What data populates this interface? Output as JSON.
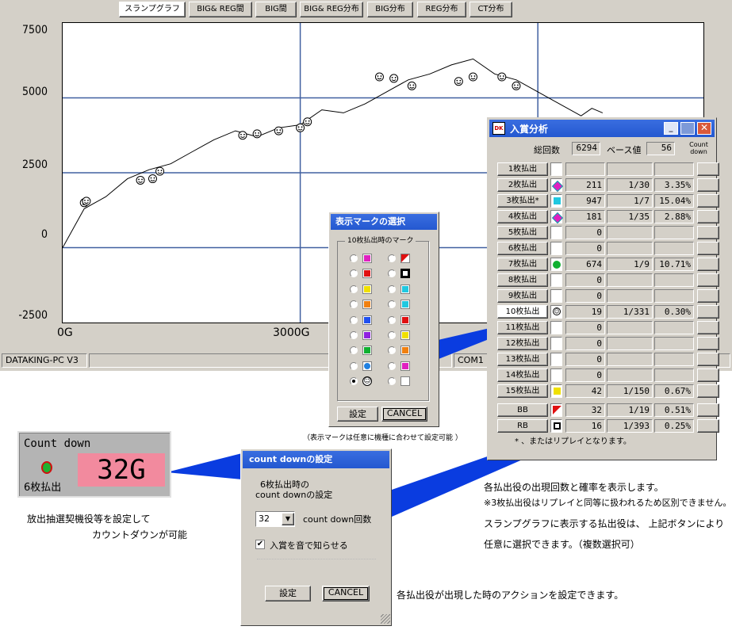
{
  "main_window": {
    "tabs": [
      {
        "label": "スランプグラフ",
        "active": true
      },
      {
        "label": "BIG& REG間",
        "active": false
      },
      {
        "label": "BIG間",
        "active": false
      },
      {
        "label": "BIG& REG分布",
        "active": false
      },
      {
        "label": "BIG分布",
        "active": false
      },
      {
        "label": "REG分布",
        "active": false
      },
      {
        "label": "CT分布",
        "active": false
      }
    ],
    "statusbar": {
      "left": "DATAKING-PC V3",
      "port": "COM1"
    }
  },
  "chart_data": {
    "type": "line",
    "title": "",
    "xlabel": "",
    "ylabel": "",
    "ylim": [
      -2500,
      7500
    ],
    "y_ticks": [
      "7500",
      "5000",
      "2500",
      "0",
      "-2500"
    ],
    "x_ticks": [
      "0G",
      "3000G"
    ],
    "x_unit": "G",
    "grid": true,
    "series": [
      {
        "points": [
          [
            0,
            0
          ],
          [
            300,
            1300
          ],
          [
            600,
            1700
          ],
          [
            900,
            2300
          ],
          [
            1200,
            2600
          ],
          [
            1500,
            2800
          ],
          [
            1800,
            3200
          ],
          [
            2100,
            3600
          ],
          [
            2400,
            3900
          ],
          [
            2700,
            3700
          ],
          [
            3000,
            4000
          ],
          [
            3300,
            4100
          ],
          [
            3600,
            4600
          ],
          [
            3900,
            4500
          ],
          [
            4200,
            4800
          ],
          [
            4500,
            5200
          ],
          [
            4800,
            5600
          ],
          [
            5100,
            5800
          ],
          [
            5400,
            6100
          ],
          [
            5700,
            6300
          ],
          [
            6000,
            5800
          ],
          [
            6300,
            5600
          ],
          [
            6600,
            5200
          ],
          [
            6900,
            4800
          ],
          [
            7200,
            4400
          ],
          [
            7350,
            4650
          ],
          [
            7500,
            4500
          ]
        ],
        "marker_points": [
          [
            300,
            1500
          ],
          [
            330,
            1550
          ],
          [
            1080,
            2250
          ],
          [
            1250,
            2300
          ],
          [
            1350,
            2550
          ],
          [
            2500,
            3750
          ],
          [
            2700,
            3800
          ],
          [
            3000,
            3900
          ],
          [
            3300,
            4000
          ],
          [
            3400,
            4200
          ],
          [
            4400,
            5700
          ],
          [
            4600,
            5650
          ],
          [
            4850,
            5400
          ],
          [
            5500,
            5550
          ],
          [
            5700,
            5700
          ],
          [
            6100,
            5700
          ],
          [
            6300,
            5400
          ]
        ]
      }
    ]
  },
  "prize_window": {
    "title": "入賞分析",
    "total_label": "総回数",
    "total_value": "6294",
    "base_label": "ベース値",
    "base_value": "56",
    "countdown_header": "Count down",
    "rows": [
      {
        "label": "1枚払出",
        "mark": "none",
        "count": "",
        "ratio": "",
        "percent": ""
      },
      {
        "label": "2枚払出",
        "mark": "magenta-diamond",
        "count": "211",
        "ratio": "1/30",
        "percent": "3.35%"
      },
      {
        "label": "3枚払出*",
        "mark": "cyan-square",
        "count": "947",
        "ratio": "1/7",
        "percent": "15.04%"
      },
      {
        "label": "4枚払出",
        "mark": "magenta-diamond",
        "count": "181",
        "ratio": "1/35",
        "percent": "2.88%"
      },
      {
        "label": "5枚払出",
        "mark": "none",
        "count": "0",
        "ratio": "",
        "percent": ""
      },
      {
        "label": "6枚払出",
        "mark": "none",
        "count": "0",
        "ratio": "",
        "percent": ""
      },
      {
        "label": "7枚払出",
        "mark": "green-circle",
        "count": "674",
        "ratio": "1/9",
        "percent": "10.71%"
      },
      {
        "label": "8枚払出",
        "mark": "none",
        "count": "0",
        "ratio": "",
        "percent": ""
      },
      {
        "label": "9枚払出",
        "mark": "none",
        "count": "0",
        "ratio": "",
        "percent": ""
      },
      {
        "label": "10枚払出",
        "mark": "smiley-face",
        "count": "19",
        "ratio": "1/331",
        "percent": "0.30%",
        "selected": true
      },
      {
        "label": "11枚払出",
        "mark": "none",
        "count": "0",
        "ratio": "",
        "percent": ""
      },
      {
        "label": "12枚払出",
        "mark": "none",
        "count": "0",
        "ratio": "",
        "percent": ""
      },
      {
        "label": "13枚払出",
        "mark": "none",
        "count": "0",
        "ratio": "",
        "percent": ""
      },
      {
        "label": "14枚払出",
        "mark": "none",
        "count": "0",
        "ratio": "",
        "percent": ""
      },
      {
        "label": "15枚払出",
        "mark": "yellow-square",
        "count": "42",
        "ratio": "1/150",
        "percent": "0.67%"
      },
      {
        "label": "BB",
        "mark": "red-flag",
        "count": "32",
        "ratio": "1/19",
        "percent": "0.51%"
      },
      {
        "label": "RB",
        "mark": "black-square",
        "count": "16",
        "ratio": "1/393",
        "percent": "0.25%"
      }
    ],
    "footnote": "*  、またはリプレイとなります。"
  },
  "mark_dialog": {
    "title": "表示マークの選択",
    "group_label": "10枚払出時のマーク",
    "ok_label": "設定",
    "cancel_label": "CANCEL",
    "caption": "（表示マークは任意に機種に合わせて設定可能 ）",
    "left_marks": [
      "magenta-square",
      "red-green-square",
      "yellow-square",
      "orange-square",
      "blue-square",
      "purple-square",
      "green-square",
      "blue-circle",
      "smiley-face"
    ],
    "right_marks": [
      "red-flag",
      "black-square",
      "cyan-square",
      "cyan-square",
      "red-square",
      "yellow-square",
      "orange-square",
      "magenta-square",
      "magenta-square",
      "empty-square"
    ],
    "selected_index": 8
  },
  "countdown_panel": {
    "title": "Count down",
    "value": "32G",
    "label": "6枚払出"
  },
  "countdown_dialog": {
    "title": "count downの設定",
    "heading_line1": "6枚払出時の",
    "heading_line2": "count downの設定",
    "select_value": "32",
    "select_label": "count down回数",
    "checkbox_label": "入賞を音で知らせる",
    "checkbox_checked": true,
    "ok_label": "設定",
    "cancel_label": "CANCEL"
  },
  "annotations": {
    "left_note_line1": "放出抽選契機役等を設定して",
    "left_note_line2": "カウントダウンが可能",
    "right_note_line1": "各払出役の出現回数と確率を表示します。",
    "right_note_line2": "※3枚払出役はリプレイと同等に扱われるため区別できません。",
    "right_note_line3": "スランプグラフに表示する払出役は、 上記ボタンにより",
    "right_note_line4": "任意に選択できます。（複数選択可）",
    "bottom_note": "各払出役が出現した時のアクションを設定できます。"
  },
  "colors": {
    "window_face": "#d4d0c8",
    "titlebar": "#2458d0",
    "countdown_bg": "#f28a9e",
    "callout": "#0a3ce0"
  }
}
